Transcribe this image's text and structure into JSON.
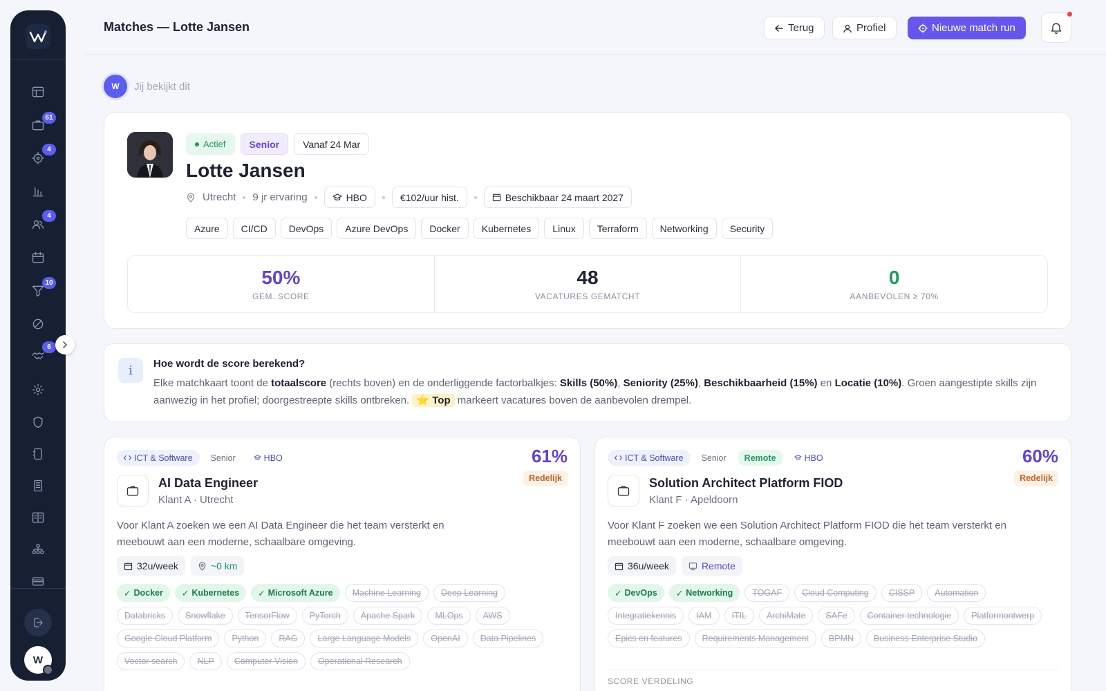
{
  "sidebar": {
    "badges": {
      "vacatures": "61",
      "matches": "4",
      "kandidaten": "4",
      "funnel": "10",
      "handshake": "6"
    },
    "user_initial": "W"
  },
  "topbar": {
    "title": "Matches — Lotte Jansen",
    "back_label": "Terug",
    "profile_label": "Profiel",
    "new_run_label": "Nieuwe match run"
  },
  "viewing": {
    "initial": "W",
    "label": "Jij bekijkt dit"
  },
  "candidate": {
    "status": "Actief",
    "level": "Senior",
    "start": "Vanaf 24 Mar",
    "name": "Lotte Jansen",
    "city": "Utrecht",
    "experience": "9 jr ervaring",
    "education": "HBO",
    "rate": "€102/uur hist.",
    "availability": "Beschikbaar 24 maart 2027",
    "skills": [
      "Azure",
      "CI/CD",
      "DevOps",
      "Azure DevOps",
      "Docker",
      "Kubernetes",
      "Linux",
      "Terraform",
      "Networking",
      "Security"
    ]
  },
  "stats": [
    {
      "value": "50%",
      "label": "GEM. SCORE",
      "color": "#6345c8"
    },
    {
      "value": "48",
      "label": "VACATURES GEMATCHT",
      "color": "#1f2233"
    },
    {
      "value": "0",
      "label": "AANBEVOLEN ≥ 70%",
      "color": "#1f9960"
    }
  ],
  "info": {
    "title": "Hoe wordt de score berekend?",
    "t1": "Elke matchkaart toont de ",
    "b1": "totaalscore",
    "t2": " (rechts boven) en de onderliggende factorbalkjes: ",
    "b2": "Skills (50%)",
    "t3": ", ",
    "b3": "Seniority (25%)",
    "t4": ", ",
    "b4": "Beschikbaarheid (15%)",
    "t5": " en ",
    "b5": "Locatie (10%)",
    "t6": ". Groen aangestipte skills zijn aanwezig in het profiel; doorgestreepte skills ontbreken. ",
    "top": "⭐ Top",
    "t7": " markeert vacatures boven de aanbevolen drempel."
  },
  "jobs": [
    {
      "category": "ICT & Software",
      "level": "Senior",
      "remote": "",
      "education": "HBO",
      "score": "61%",
      "score_label": "Redelijk",
      "title": "AI Data Engineer",
      "client": "Klant A · Utrecht",
      "desc": "Voor Klant A zoeken we een AI Data Engineer die het team versterkt en meebouwt aan een moderne, schaalbare omgeving.",
      "hours": "32u/week",
      "extra": "~0 km",
      "have": [
        "Docker",
        "Kubernetes",
        "Microsoft Azure"
      ],
      "missing": [
        "Machine Learning",
        "Deep Learning",
        "Databricks",
        "Snowflake",
        "TensorFlow",
        "PyTorch",
        "Apache Spark",
        "MLOps",
        "AWS",
        "Google Cloud Platform",
        "Python",
        "RAG",
        "Large Language Models",
        "OpenAI",
        "Data Pipelines",
        "Vector search",
        "NLP",
        "Computer Vision",
        "Operational Research"
      ]
    },
    {
      "category": "ICT & Software",
      "level": "Senior",
      "remote": "Remote",
      "education": "HBO",
      "score": "60%",
      "score_label": "Redelijk",
      "title": "Solution Architect Platform FIOD",
      "client": "Klant F · Apeldoorn",
      "desc": "Voor Klant F zoeken we een Solution Architect Platform FIOD die het team versterkt en meebouwt aan een moderne, schaalbare omgeving.",
      "hours": "36u/week",
      "extra": "Remote",
      "have": [
        "DevOps",
        "Networking"
      ],
      "missing": [
        "TOGAF",
        "Cloud Computing",
        "CISSP",
        "Automation",
        "Integratiekennis",
        "IAM",
        "ITIL",
        "ArchiMate",
        "SAFe",
        "Container technologie",
        "Platformontwerp",
        "Epics en features",
        "Requirements Management",
        "BPMN",
        "Business Enterprise Studio"
      ],
      "section": "SCORE VERDELING"
    }
  ]
}
